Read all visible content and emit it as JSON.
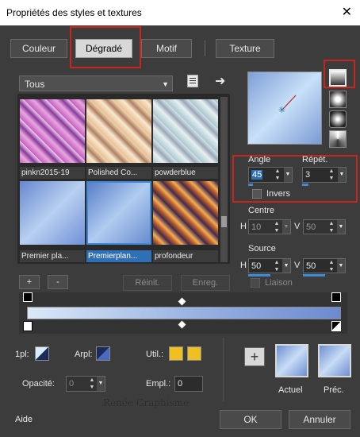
{
  "window": {
    "title": "Propriétés des styles et textures",
    "close_glyph": "✕"
  },
  "tabs": [
    {
      "label": "Couleur"
    },
    {
      "label": "Dégradé"
    },
    {
      "label": "Motif"
    },
    {
      "label": "Texture"
    }
  ],
  "category": {
    "selected": "Tous"
  },
  "gradients": [
    {
      "name": "pinkn2015-19"
    },
    {
      "name": "Polished Co..."
    },
    {
      "name": "powderblue"
    },
    {
      "name": "Premier pla..."
    },
    {
      "name": "Premierplan...",
      "selected": true
    },
    {
      "name": "profondeur"
    }
  ],
  "list_buttons": {
    "add": "+",
    "remove": "-",
    "reset": "Réinit.",
    "save": "Enreg."
  },
  "angle": {
    "label": "Angle",
    "value": "45"
  },
  "repeat": {
    "label": "Répét.",
    "value": "3"
  },
  "invert": {
    "label": "Invers"
  },
  "centre": {
    "label": "Centre",
    "h_label": "H",
    "h_value": "10",
    "v_label": "V",
    "v_value": "50"
  },
  "source": {
    "label": "Source",
    "h_label": "H",
    "h_value": "50",
    "v_label": "V",
    "v_value": "50"
  },
  "link": {
    "label": "Liaison"
  },
  "stops": {
    "first_label": "1pl:",
    "back_label": "Arpl:",
    "user_label": "Util.:",
    "opacity_label": "Opacité:",
    "opacity_value": "0",
    "location_label": "Empl.:",
    "location_value": "0"
  },
  "previews": {
    "current_label": "Actuel",
    "previous_label": "Préc.",
    "add_glyph": "+"
  },
  "footer": {
    "help_label": "Aide",
    "ok_label": "OK",
    "cancel_label": "Annuler"
  },
  "watermark": "Renée Graphisme",
  "colors": {
    "accent": "#3c8ad8",
    "highlight": "#c8261c",
    "user_swatch": "#f0c020",
    "dialog_bg": "#3c3c3c"
  }
}
